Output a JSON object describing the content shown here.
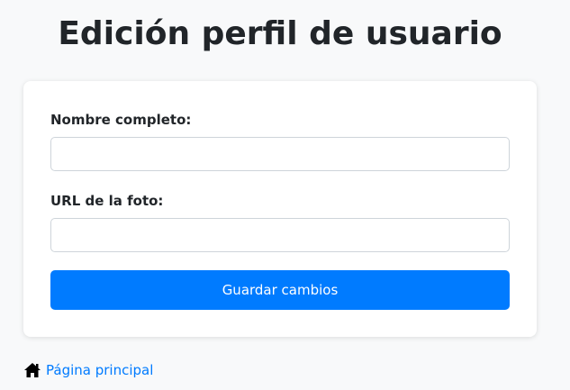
{
  "page": {
    "title": "Edición perfil de usuario"
  },
  "form": {
    "name_label": "Nombre completo:",
    "name_value": "",
    "name_placeholder": "",
    "photo_label": "URL de la foto:",
    "photo_value": "",
    "photo_placeholder": "",
    "save_label": "Guardar cambios"
  },
  "footer": {
    "home_link_label": "Página principal",
    "home_icon": "home-icon"
  },
  "colors": {
    "accent": "#007bff",
    "background": "#f8f9fa",
    "card": "#ffffff",
    "text": "#212529"
  }
}
